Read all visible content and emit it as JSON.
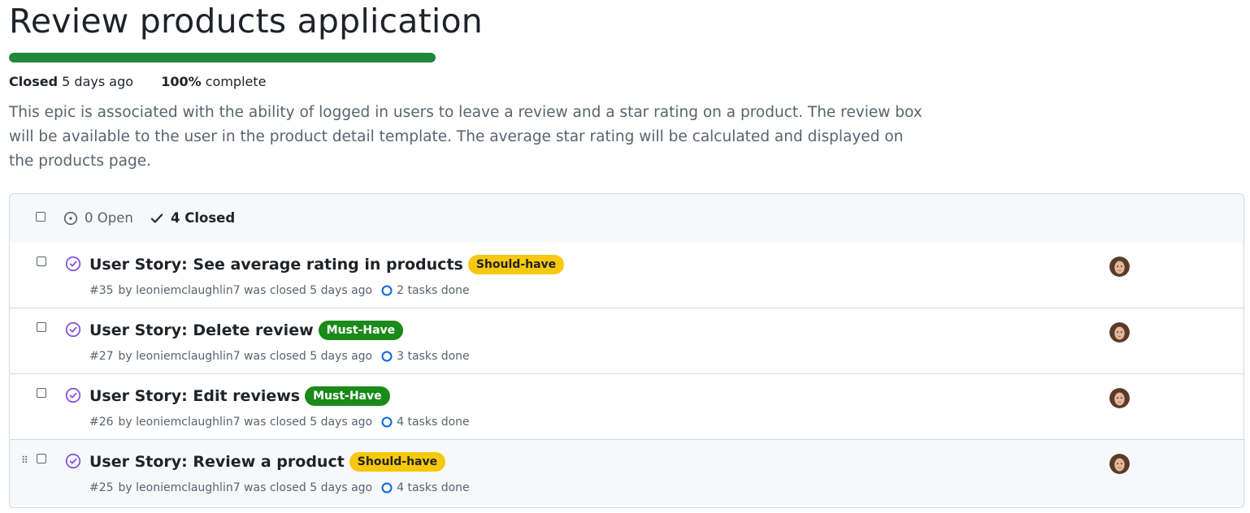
{
  "epic": {
    "title": "Review products application",
    "progress_fraction": 1.0,
    "status": "Closed",
    "closed_ago": "5 days ago",
    "percent": "100%",
    "percent_suffix": "complete",
    "description": "This epic is associated with the ability of logged in users to leave a review and a star rating on a product. The review box will be available to the user in the product detail template. The average star rating will be calculated and displayed on the products page."
  },
  "filters": {
    "open_label": "0 Open",
    "closed_label": "4 Closed"
  },
  "colors": {
    "progress": "#1f883d",
    "closed_icon": "#8250df",
    "task_ring": "#0969da",
    "should_have": "#f8c80c",
    "must_have": "#1a8a1a"
  },
  "issues": [
    {
      "title": "User Story: See average rating in products",
      "label": "Should-have",
      "label_type": "should",
      "number": "#35",
      "byline": "by leoniemclaughlin7 was closed 5 days ago",
      "tasks": "2 tasks done"
    },
    {
      "title": "User Story: Delete review",
      "label": "Must-Have",
      "label_type": "must",
      "number": "#27",
      "byline": "by leoniemclaughlin7 was closed 5 days ago",
      "tasks": "3 tasks done"
    },
    {
      "title": "User Story: Edit reviews",
      "label": "Must-Have",
      "label_type": "must",
      "number": "#26",
      "byline": "by leoniemclaughlin7 was closed 5 days ago",
      "tasks": "4 tasks done"
    },
    {
      "title": "User Story: Review a product",
      "label": "Should-have",
      "label_type": "should",
      "number": "#25",
      "byline": "by leoniemclaughlin7 was closed 5 days ago",
      "tasks": "4 tasks done"
    }
  ]
}
